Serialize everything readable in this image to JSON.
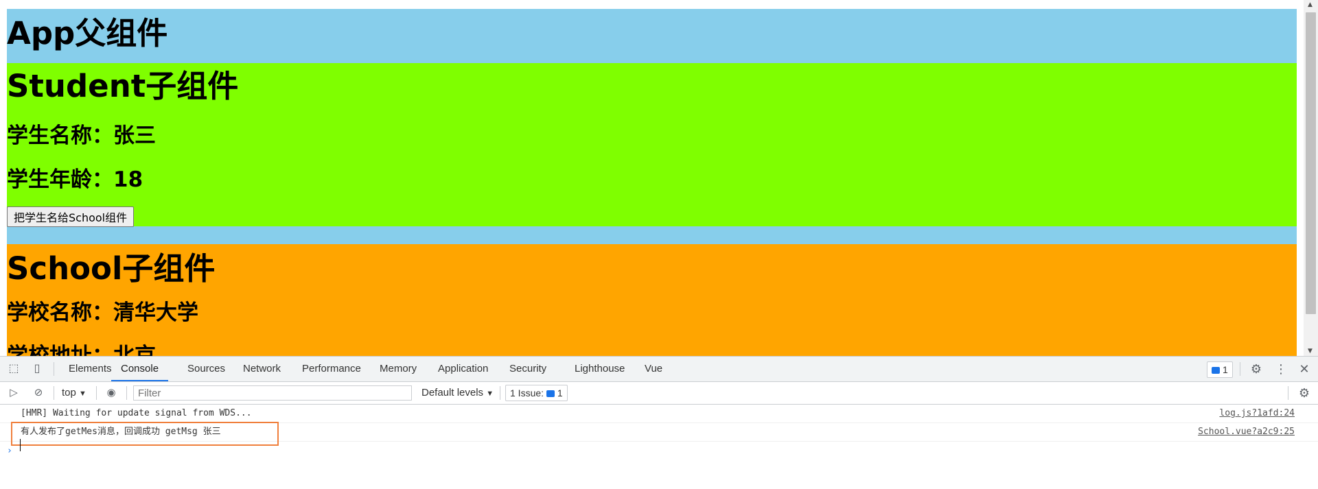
{
  "page": {
    "app_title": "App父组件",
    "student": {
      "title": "Student子组件",
      "name_line": "学生名称：张三",
      "age_line": "学生年龄：18",
      "button_label": "把学生名给School组件"
    },
    "school": {
      "title": "School子组件",
      "name_line": "学校名称：清华大学",
      "address_line": "学校地址：北京"
    },
    "colors": {
      "app_bg": "#87CEEB",
      "student_bg": "#7FFF00",
      "school_bg": "#FFA500",
      "highlight_border": "#F07F3C"
    }
  },
  "devtools": {
    "tabs": [
      {
        "label": "Elements",
        "active": false
      },
      {
        "label": "Console",
        "active": true
      },
      {
        "label": "Sources",
        "active": false
      },
      {
        "label": "Network",
        "active": false
      },
      {
        "label": "Performance",
        "active": false
      },
      {
        "label": "Memory",
        "active": false
      },
      {
        "label": "Application",
        "active": false
      },
      {
        "label": "Security",
        "active": false
      },
      {
        "label": "Lighthouse",
        "active": false
      },
      {
        "label": "Vue",
        "active": false
      }
    ],
    "issues_badge_count": "1",
    "toolbar": {
      "context": "top",
      "filter_placeholder": "Filter",
      "levels": "Default levels",
      "issues_label": "1 Issue:",
      "issues_count": "1"
    },
    "console": [
      {
        "text": "[HMR] Waiting for update signal from WDS...",
        "source": "log.js?1afd:24"
      },
      {
        "text": "有人发布了getMes消息，回调成功 getMsg 张三",
        "source": "School.vue?a2c9:25"
      }
    ],
    "prompt_symbol": "›",
    "icons": [
      "inspect-element-icon",
      "device-toolbar-icon",
      "settings-gear-icon",
      "more-vertical-icon",
      "close-icon",
      "sidebar-toggle-icon",
      "clear-console-icon",
      "eye-icon",
      "chevron-down-icon"
    ]
  }
}
